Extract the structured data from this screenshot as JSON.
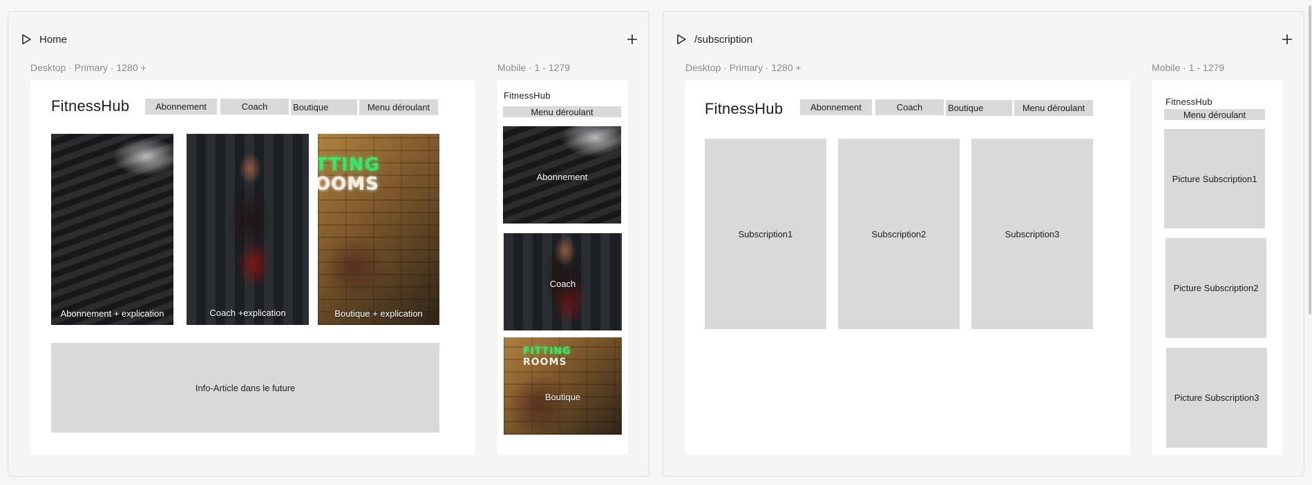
{
  "panels": [
    {
      "title": "Home",
      "desktop": {
        "label": "Desktop · Primary · 1280 +",
        "brand": "FitnessHub",
        "nav": [
          "Abonnement",
          "Coach",
          "Boutique",
          "Menu déroulant"
        ],
        "cards": [
          {
            "caption": "Abonnement + explication",
            "photo": "dumbbell-rack"
          },
          {
            "caption": "Coach +explication",
            "photo": "coach-in-gym"
          },
          {
            "caption": "Boutique + explication",
            "photo": "fitting-rooms-store"
          }
        ],
        "article": "Info-Article dans le future"
      },
      "mobile": {
        "label": "Mobile · 1 - 1279",
        "brand": "FitnessHub",
        "menu": "Menu déroulant",
        "cards": [
          {
            "caption": "Abonnement",
            "photo": "dumbbell-rack"
          },
          {
            "caption": "Coach",
            "photo": "coach-in-gym"
          },
          {
            "caption": "Boutique",
            "photo": "fitting-rooms-store"
          }
        ],
        "neon_text": [
          "FITTING",
          "ROOMS"
        ]
      }
    },
    {
      "title": "/subscription",
      "desktop": {
        "label": "Desktop · Primary · 1280 +",
        "brand": "FitnessHub",
        "nav": [
          "Abonnement",
          "Coach",
          "Boutique",
          "Menu déroulant"
        ],
        "cards": [
          "Subscription1",
          "Subscription2",
          "Subscription3"
        ]
      },
      "mobile": {
        "label": "Mobile · 1 - 1279",
        "brand": "FitnessHub",
        "menu": "Menu déroulant",
        "cards": [
          "Picture Subscription1",
          "Picture Subscription2",
          "Picture Subscription3"
        ]
      }
    }
  ],
  "desktop_neon_text": [
    "TTING",
    "OOMS"
  ],
  "colors": {
    "placeholder": "#d9d9d9",
    "frame": "#ffffff",
    "canvas": "#f5f5f5",
    "label": "#8a8a8a",
    "neon_green": "#3fe36a"
  },
  "icons": {
    "run": "play-icon",
    "add": "plus-icon"
  }
}
